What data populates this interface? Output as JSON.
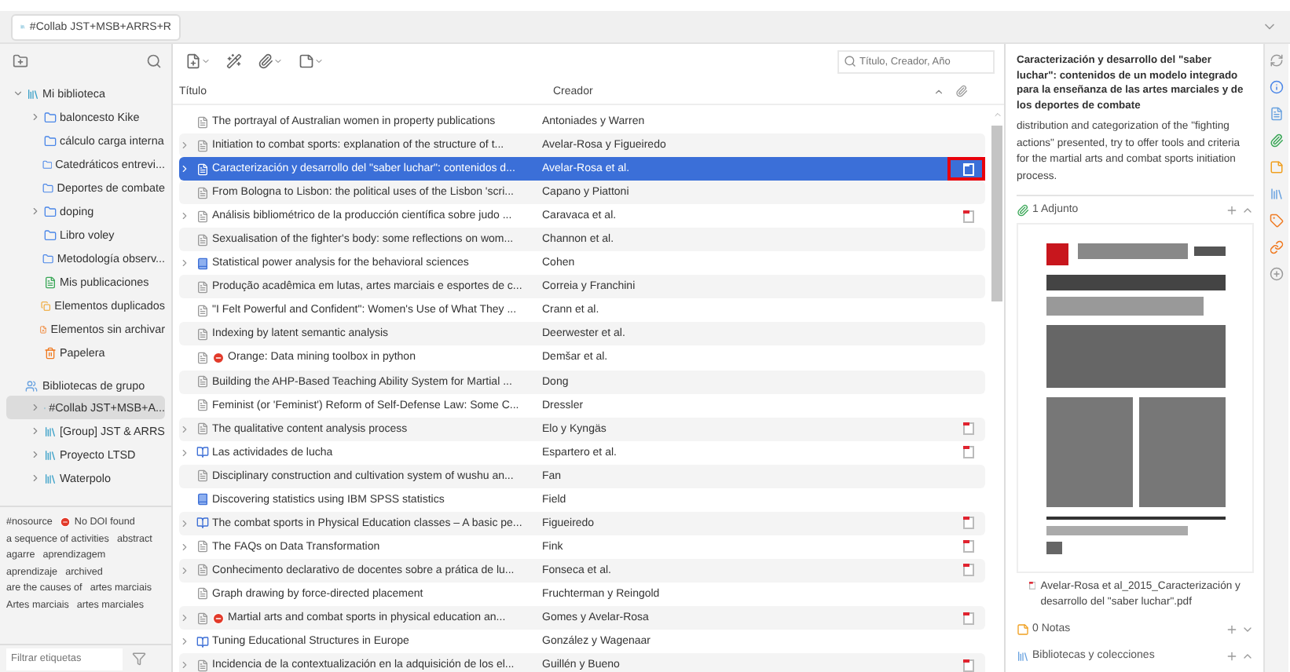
{
  "tab": {
    "label": "#Collab JST+MSB+ARRS+R"
  },
  "collections": {
    "root": {
      "label": "Mi biblioteca",
      "expanded": true,
      "children": [
        {
          "label": "baloncesto Kike",
          "kind": "folder",
          "expandable": true
        },
        {
          "label": "cálculo carga interna",
          "kind": "folder",
          "expandable": false
        },
        {
          "label": "Catedráticos entrevi...",
          "kind": "folder",
          "expandable": false
        },
        {
          "label": "Deportes de combate",
          "kind": "folder",
          "expandable": false
        },
        {
          "label": "doping",
          "kind": "folder",
          "expandable": true
        },
        {
          "label": "Libro voley",
          "kind": "folder",
          "expandable": false
        },
        {
          "label": "Metodología observ...",
          "kind": "folder",
          "expandable": false
        },
        {
          "label": "Mis publicaciones",
          "kind": "publications",
          "expandable": false
        },
        {
          "label": "Elementos duplicados",
          "kind": "duplicates",
          "expandable": false
        },
        {
          "label": "Elementos sin archivar",
          "kind": "unfiled",
          "expandable": false
        },
        {
          "label": "Papelera",
          "kind": "trash",
          "expandable": false
        }
      ]
    },
    "groups_header": "Bibliotecas de grupo",
    "groups": [
      {
        "label": "#Collab JST+MSB+A...",
        "selected": true
      },
      {
        "label": "[Group] JST & ARRS",
        "selected": false
      },
      {
        "label": "Proyecto LTSD",
        "selected": false
      },
      {
        "label": "Waterpolo",
        "selected": false
      }
    ]
  },
  "tags": [
    {
      "label": "#nosource",
      "kind": "plain"
    },
    {
      "label": "No DOI found",
      "kind": "error"
    },
    {
      "label": "a sequence of activities",
      "kind": "plain"
    },
    {
      "label": "abstract",
      "kind": "plain"
    },
    {
      "label": "agarre",
      "kind": "plain"
    },
    {
      "label": "aprendizagem",
      "kind": "plain"
    },
    {
      "label": "aprendizaje",
      "kind": "plain"
    },
    {
      "label": "archived",
      "kind": "plain"
    },
    {
      "label": "are the causes of",
      "kind": "plain"
    },
    {
      "label": "artes marciais",
      "kind": "plain"
    },
    {
      "label": "Artes marciais",
      "kind": "plain"
    },
    {
      "label": "artes marciales",
      "kind": "plain"
    }
  ],
  "tag_filter": {
    "placeholder": "Filtrar etiquetas"
  },
  "search": {
    "placeholder": "Título, Creador, Año"
  },
  "columns": [
    "Título",
    "Creador"
  ],
  "rows": [
    {
      "title": "The portrayal of Australian women in property publications",
      "creator": "Antoniades y Warren",
      "kind": "document",
      "expandable": false,
      "error": false,
      "attachment": false,
      "selected": false
    },
    {
      "title": "Initiation to combat sports: explanation of the structure of t...",
      "creator": "Avelar-Rosa y Figueiredo",
      "kind": "document",
      "expandable": true,
      "error": false,
      "attachment": false,
      "selected": false
    },
    {
      "title": "Caracterización y desarrollo del \"saber luchar\": contenidos d...",
      "creator": "Avelar-Rosa et al.",
      "kind": "document",
      "expandable": true,
      "error": false,
      "attachment": true,
      "selected": true,
      "marked": true
    },
    {
      "title": "From Bologna to Lisbon: the political uses of the Lisbon 'scri...",
      "creator": "Capano y Piattoni",
      "kind": "document",
      "expandable": false,
      "error": false,
      "attachment": false,
      "selected": false
    },
    {
      "title": "Análisis bibliométrico de la producción científica sobre judo ...",
      "creator": "Caravaca et al.",
      "kind": "document",
      "expandable": true,
      "error": false,
      "attachment": true,
      "selected": false
    },
    {
      "title": "Sexualisation of the fighter's body: some reflections on wom...",
      "creator": "Channon et al.",
      "kind": "document",
      "expandable": false,
      "error": false,
      "attachment": false,
      "selected": false
    },
    {
      "title": "Statistical power analysis for the behavioral sciences",
      "creator": "Cohen",
      "kind": "book",
      "expandable": true,
      "error": false,
      "attachment": false,
      "selected": false
    },
    {
      "title": "Produção acadêmica em lutas, artes marciais e esportes de c...",
      "creator": "Correia y Franchini",
      "kind": "document",
      "expandable": false,
      "error": false,
      "attachment": false,
      "selected": false
    },
    {
      "title": "\"I Felt Powerful and Confident\": Women's Use of What They ...",
      "creator": "Crann et al.",
      "kind": "document",
      "expandable": false,
      "error": false,
      "attachment": false,
      "selected": false
    },
    {
      "title": "Indexing by latent semantic analysis",
      "creator": "Deerwester et al.",
      "kind": "document",
      "expandable": false,
      "error": false,
      "attachment": false,
      "selected": false
    },
    {
      "title": "Orange: Data mining toolbox in python",
      "creator": "Demšar et al.",
      "kind": "document",
      "expandable": false,
      "error": true,
      "attachment": false,
      "selected": false
    },
    {
      "title": "Building the AHP-Based Teaching Ability System for Martial ...",
      "creator": "Dong",
      "kind": "document",
      "expandable": false,
      "error": false,
      "attachment": false,
      "selected": false
    },
    {
      "title": "Feminist (or 'Feminist') Reform of Self-Defense Law: Some C...",
      "creator": "Dressler",
      "kind": "document",
      "expandable": false,
      "error": false,
      "attachment": false,
      "selected": false
    },
    {
      "title": "The qualitative content analysis process",
      "creator": "Elo y Kyngäs",
      "kind": "document",
      "expandable": true,
      "error": false,
      "attachment": true,
      "selected": false
    },
    {
      "title": "Las actividades de lucha",
      "creator": "Espartero et al.",
      "kind": "section",
      "expandable": true,
      "error": false,
      "attachment": true,
      "selected": false
    },
    {
      "title": "Disciplinary construction and cultivation system of wushu an...",
      "creator": "Fan",
      "kind": "document",
      "expandable": false,
      "error": false,
      "attachment": false,
      "selected": false
    },
    {
      "title": "Discovering statistics using IBM SPSS statistics",
      "creator": "Field",
      "kind": "book",
      "expandable": false,
      "error": false,
      "attachment": false,
      "selected": false
    },
    {
      "title": "The combat sports in Physical Education classes – A basic pe...",
      "creator": "Figueiredo",
      "kind": "section",
      "expandable": true,
      "error": false,
      "attachment": true,
      "selected": false
    },
    {
      "title": "The FAQs on Data Transformation",
      "creator": "Fink",
      "kind": "document",
      "expandable": true,
      "error": false,
      "attachment": true,
      "selected": false
    },
    {
      "title": "Conhecimento declarativo de docentes sobre a prática de lu...",
      "creator": "Fonseca et al.",
      "kind": "document",
      "expandable": true,
      "error": false,
      "attachment": true,
      "selected": false
    },
    {
      "title": "Graph drawing by force-directed placement",
      "creator": "Fruchterman y Reingold",
      "kind": "document",
      "expandable": false,
      "error": false,
      "attachment": false,
      "selected": false
    },
    {
      "title": "Martial arts and combat sports in physical education an...",
      "creator": "Gomes y Avelar-Rosa",
      "kind": "document",
      "expandable": true,
      "error": true,
      "attachment": true,
      "selected": false
    },
    {
      "title": "Tuning Educational Structures in Europe",
      "creator": "González y Wagenaar",
      "kind": "section",
      "expandable": true,
      "error": false,
      "attachment": false,
      "selected": false
    },
    {
      "title": "Incidencia de la contextualización en la adquisición de los el...",
      "creator": "Guillén y Bueno",
      "kind": "document",
      "expandable": true,
      "error": false,
      "attachment": true,
      "selected": false
    }
  ],
  "item_pane": {
    "title": "Caracterización y desarrollo del \"saber luchar\": contenidos de un modelo integrado para la enseñanza de las artes marciales y de los deportes de combate",
    "abstract": "distribution and categorization of the \"fighting actions\" presented, try to offer tools and criteria for the martial arts and combat sports initiation process.",
    "sections": [
      {
        "label": "1 Adjunto",
        "kind": "attachments",
        "expanded": true
      },
      {
        "label": "0 Notas",
        "kind": "notes",
        "expanded": false
      },
      {
        "label": "Bibliotecas y colecciones",
        "kind": "libraries",
        "expanded": true
      }
    ],
    "attachment_file": "Avelar-Rosa et al_2015_Caracterización y desarrollo del \"saber luchar\".pdf"
  }
}
